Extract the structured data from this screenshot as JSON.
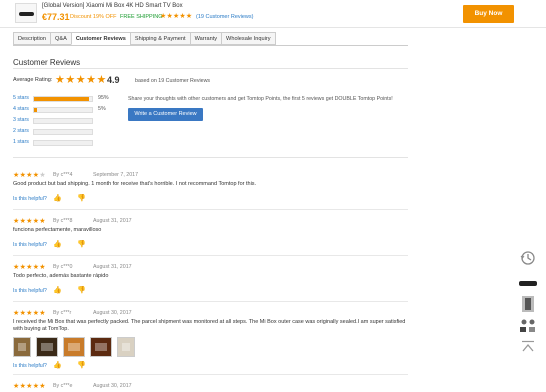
{
  "product": {
    "title": "[Global Version] Xiaomi Mi Box 4K HD Smart TV Box",
    "price": "€77.31",
    "discount": "Discount 19% OFF",
    "free_shipping": "FREE SHIPPING",
    "stars": "★★★★★",
    "reviews_link": "(19 Customer Reviews)",
    "buy_label": "Buy Now"
  },
  "tabs": [
    "Description",
    "Q&A",
    "Customer Reviews",
    "Shipping & Payment",
    "Warranty",
    "Wholesale Inquiry"
  ],
  "summary": {
    "title": "Customer Reviews",
    "avg_label": "Average Rating:",
    "avg_stars": "★★★★★",
    "avg_value": "4.9",
    "based_on": "based on 19 Customer Reviews",
    "bars": [
      {
        "label": "5 stars",
        "pct_text": "95%",
        "fraction": 0.95
      },
      {
        "label": "4 stars",
        "pct_text": "5%",
        "fraction": 0.05
      },
      {
        "label": "3 stars",
        "pct_text": "",
        "fraction": 0
      },
      {
        "label": "2 stars",
        "pct_text": "",
        "fraction": 0
      },
      {
        "label": "1 stars",
        "pct_text": "",
        "fraction": 0
      }
    ],
    "share_text": "Share your thoughts with other customers and get Tomtop Points, the first 5 reviews get DOUBLE Tomtop Points!",
    "write_button": "Write a Customer Review"
  },
  "reviews": [
    {
      "stars_filled": "★★★★",
      "stars_empty": "★",
      "by": "By c***4",
      "date": "September 7, 2017",
      "text": "Good product but bad shipping. 1 month for receive that's horrible. I not recommand Tomtop for this.",
      "helpful": "Is this helpful?"
    },
    {
      "stars_filled": "★★★★★",
      "stars_empty": "",
      "by": "By c***8",
      "date": "August 31, 2017",
      "text": "funciona perfectamente, maravilloso",
      "helpful": "Is this helpful?"
    },
    {
      "stars_filled": "★★★★★",
      "stars_empty": "",
      "by": "By c***0",
      "date": "August 31, 2017",
      "text": "Todo perfecto, además bastante rápido",
      "helpful": "Is this helpful?"
    },
    {
      "stars_filled": "★★★★★",
      "stars_empty": "",
      "by": "By c***r",
      "date": "August 30, 2017",
      "text": "I received the Mi Box that was perfectly packed. The parcel shipment was monitored at all steps. The Mi Box outer case was originally sealed.I am super satisfied with buying at TomTop.",
      "helpful": "Is this helpful?"
    },
    {
      "stars_filled": "★★★★★",
      "stars_empty": "",
      "by": "By c***e",
      "date": "August 30, 2017",
      "text": "",
      "helpful": ""
    }
  ],
  "icons": {
    "thumbs_up": "👍",
    "thumbs_down": "👎",
    "history": "history-icon",
    "back_to_top": "back-to-top-icon"
  },
  "colors": {
    "accent": "#f29200",
    "link": "#2a7bc6",
    "button_blue": "#3a78c3",
    "free_shipping": "#1a9b2f"
  }
}
